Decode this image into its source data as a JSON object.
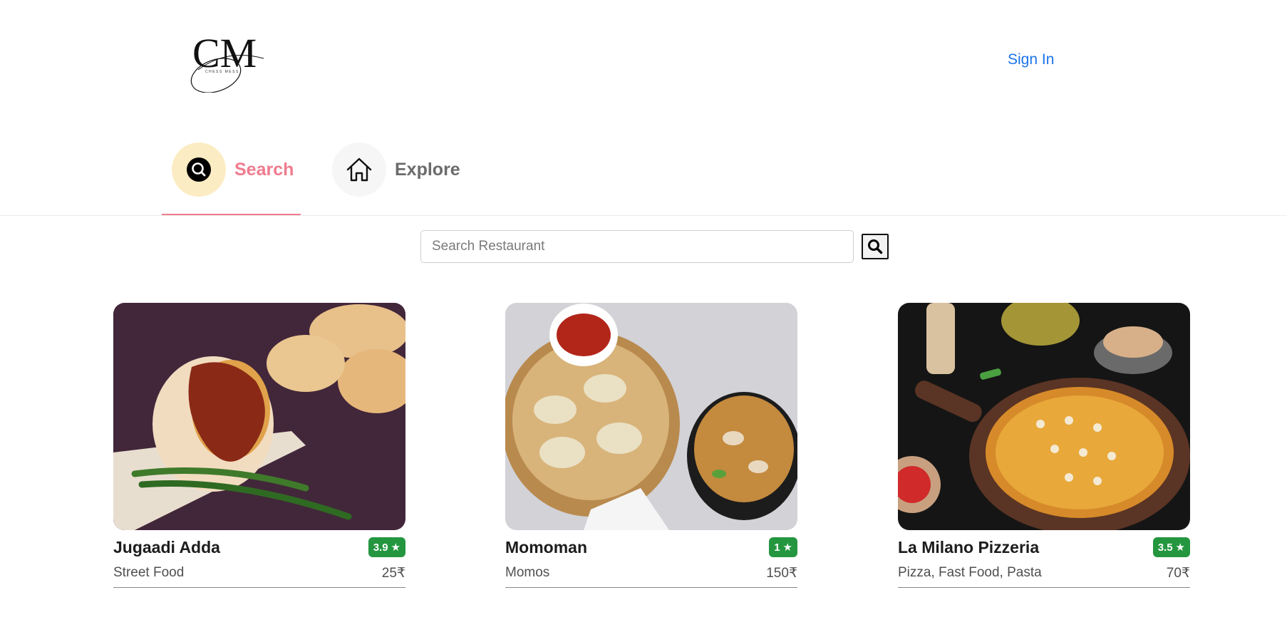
{
  "header": {
    "logo_initials": "CM",
    "logo_subtext": "CHESS MESS",
    "signin_label": "Sign In"
  },
  "tabs": [
    {
      "label": "Search",
      "icon": "search-icon",
      "active": true
    },
    {
      "label": "Explore",
      "icon": "home-icon",
      "active": false
    }
  ],
  "search": {
    "placeholder": "Search Restaurant",
    "value": "",
    "button_icon": "search-icon"
  },
  "restaurants": [
    {
      "name": "Jugaadi Adda",
      "rating": "3.9",
      "cuisine": "Street Food",
      "price": "25₹",
      "image": "vada-pav-photo"
    },
    {
      "name": "Momoman",
      "rating": "1",
      "cuisine": "Momos",
      "price": "150₹",
      "image": "momos-noodles-photo"
    },
    {
      "name": "La Milano Pizzeria",
      "rating": "3.5",
      "cuisine": "Pizza, Fast Food, Pasta",
      "price": "70₹",
      "image": "pizza-photo"
    }
  ],
  "colors": {
    "accent": "#ef7c8e",
    "link": "#1a73e8",
    "rating_bg": "#24963f",
    "search_tab_bg": "#fcecc3"
  }
}
